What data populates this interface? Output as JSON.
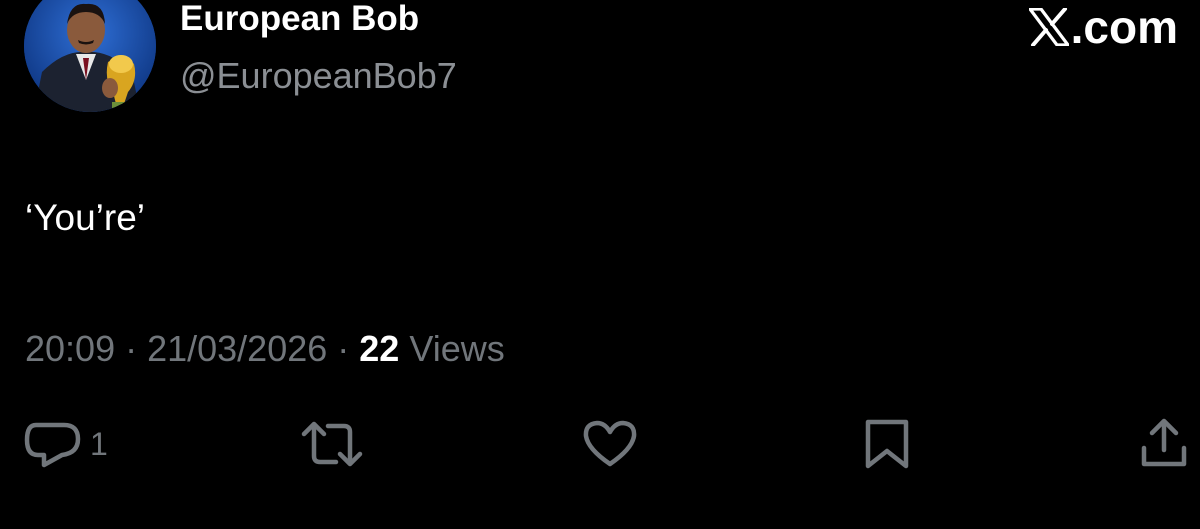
{
  "author": {
    "display_name": "European Bob",
    "handle": "@EuropeanBob7",
    "avatar_icon": "profile-photo-man-holding-gold-trophy"
  },
  "brand": {
    "label": ".com",
    "logo_icon": "x-logo-icon"
  },
  "post": {
    "text": "‘You’re’"
  },
  "meta": {
    "time": "20:09",
    "separator": " · ",
    "date": "21/03/2026",
    "views_count": "22",
    "views_label": " Views"
  },
  "actions": {
    "reply_count": "1",
    "icons": [
      "reply-icon",
      "repost-icon",
      "like-icon",
      "bookmark-icon",
      "share-icon"
    ]
  },
  "colors": {
    "background": "#000000",
    "primary_text": "#ffffff",
    "secondary_text": "#71767b"
  }
}
